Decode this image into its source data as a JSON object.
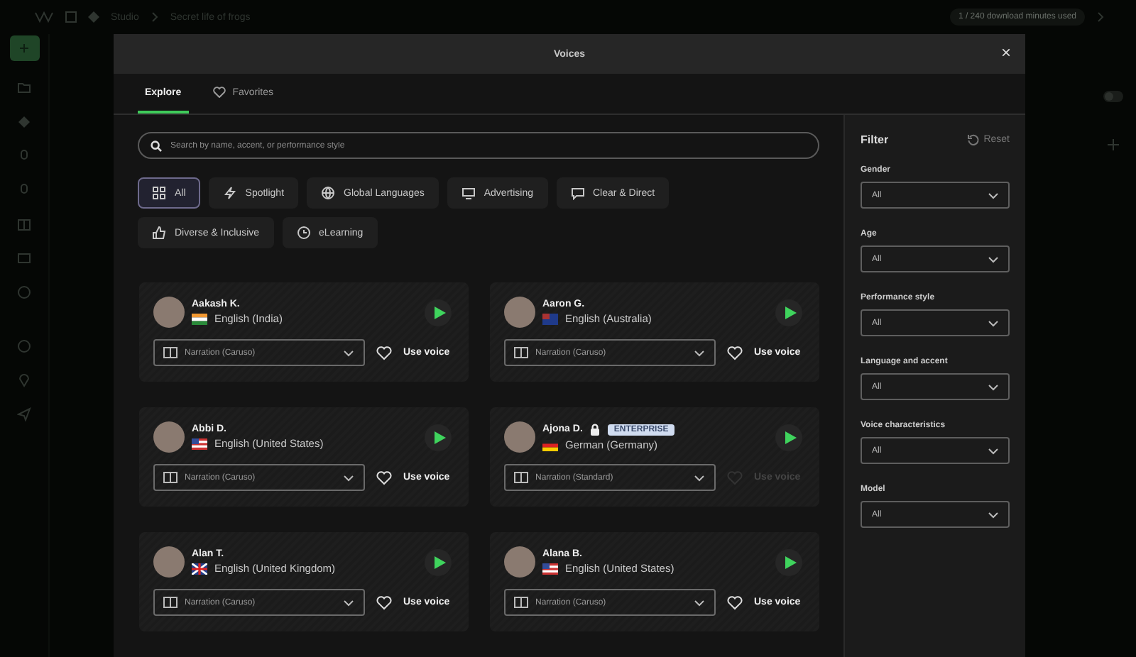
{
  "app": {
    "breadcrumbs": [
      "Studio",
      "Secret life of frogs"
    ],
    "usage": "1 / 240 download minutes used",
    "toggle": {
      "on": false
    }
  },
  "modal": {
    "title": "Voices",
    "close": "×",
    "tabs": [
      {
        "label": "Explore",
        "selected": true,
        "kind": "plain"
      },
      {
        "label": "Favorites",
        "selected": false,
        "kind": "heart"
      }
    ],
    "search": {
      "placeholder": "Search by name, accent, or performance style"
    },
    "categories": [
      {
        "label": "All",
        "selected": true,
        "kind": "grid"
      },
      {
        "label": "Spotlight",
        "selected": false,
        "kind": "bolt"
      },
      {
        "label": "Global Languages",
        "selected": false,
        "kind": "globe"
      },
      {
        "label": "Advertising",
        "selected": false,
        "kind": "screen"
      },
      {
        "label": "Clear & Direct",
        "selected": false,
        "kind": "speech"
      },
      {
        "label": "Diverse & Inclusive",
        "selected": false,
        "kind": "thumb"
      },
      {
        "label": "eLearning",
        "selected": false,
        "kind": "clock"
      }
    ],
    "voices": [
      {
        "name": "Aakash K.",
        "kind": "in",
        "language": "English (India)",
        "model": "Narration (Caruso)",
        "action": "Use voice",
        "disabled": false
      },
      {
        "name": "Aaron G.",
        "kind": "au",
        "language": "English (Australia)",
        "model": "Narration (Caruso)",
        "action": "Use voice",
        "disabled": false
      },
      {
        "name": "Abbi D.",
        "kind": "us",
        "language": "English (United States)",
        "model": "Narration (Caruso)",
        "action": "Use voice",
        "disabled": false
      },
      {
        "name": "Ajona D.",
        "kind": "de",
        "language": "German (Germany)",
        "badge": "ENTERPRISE",
        "model": "Narration (Standard)",
        "action": "Use voice",
        "disabled": true
      },
      {
        "name": "Alan T.",
        "kind": "gb",
        "language": "English (United Kingdom)",
        "model": "Narration (Caruso)",
        "action": "Use voice",
        "disabled": false
      },
      {
        "name": "Alana B.",
        "kind": "us",
        "language": "English (United States)",
        "model": "Narration (Caruso)",
        "action": "Use voice",
        "disabled": false
      }
    ],
    "filter": {
      "title": "Filter",
      "reset": "Reset",
      "fields": [
        {
          "label": "Gender",
          "value": "All"
        },
        {
          "label": "Age",
          "value": "All"
        },
        {
          "label": "Performance style",
          "value": "All"
        },
        {
          "label": "Language and accent",
          "value": "All"
        },
        {
          "label": "Voice characteristics",
          "value": "All"
        },
        {
          "label": "Model",
          "value": "All"
        }
      ]
    }
  }
}
